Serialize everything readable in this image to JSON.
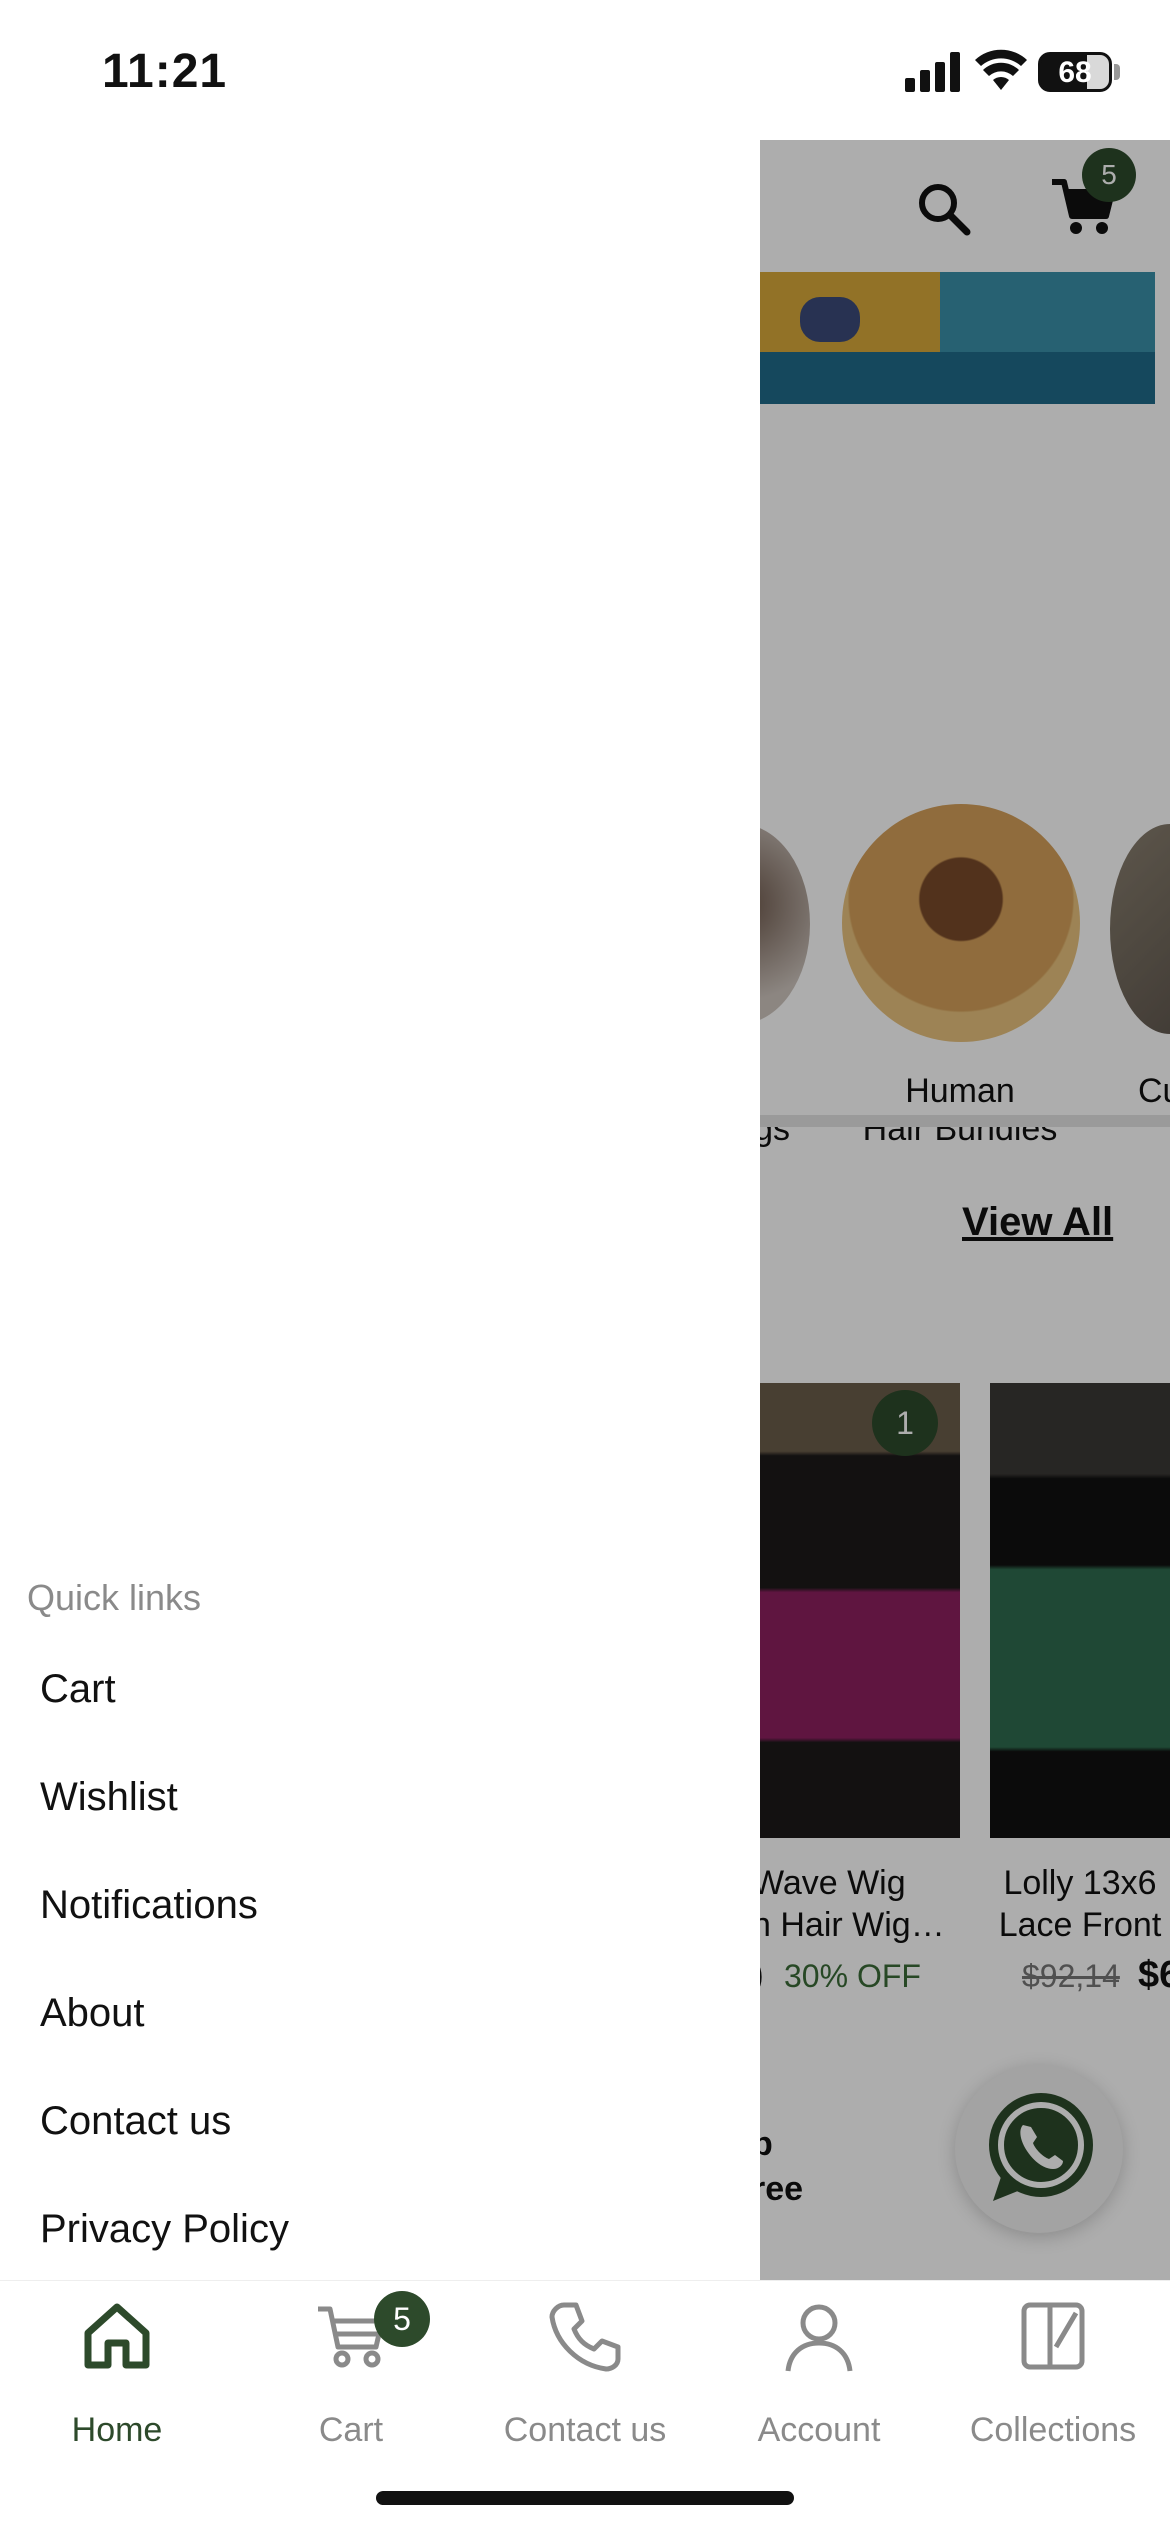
{
  "status_bar": {
    "time": "11:21",
    "battery": "68"
  },
  "header": {
    "cart_count": "5"
  },
  "categories": [
    {
      "label": "gs"
    },
    {
      "label_line1": "Human",
      "label_line2": "Hair Bundles"
    },
    {
      "label": "Cu"
    }
  ],
  "section": {
    "view_all": "View All"
  },
  "products": [
    {
      "badge": "1",
      "title_line1": "Wave Wig",
      "title_line2": "n Hair Wig…",
      "price_fragment": ")",
      "discount": "30% OFF"
    },
    {
      "title_line1": "Lolly 13x6",
      "title_line2": "Lace Front",
      "old_price": "$92,14",
      "new_price": "$6"
    }
  ],
  "promo": {
    "line1": "p",
    "line2": "ree"
  },
  "drawer": {
    "title": "Quick links",
    "items": [
      "Cart",
      "Wishlist",
      "Notifications",
      "About",
      "Contact us",
      "Privacy Policy"
    ]
  },
  "bottom_nav": {
    "items": [
      {
        "label": "Home",
        "icon": "home-icon"
      },
      {
        "label": "Cart",
        "icon": "cart-icon",
        "badge": "5"
      },
      {
        "label": "Contact us",
        "icon": "phone-icon"
      },
      {
        "label": "Account",
        "icon": "account-icon"
      },
      {
        "label": "Collections",
        "icon": "collections-icon"
      }
    ]
  },
  "colors": {
    "accent": "#2d4a2b",
    "discount": "#3a6b37",
    "muted": "#8a8a8a"
  }
}
